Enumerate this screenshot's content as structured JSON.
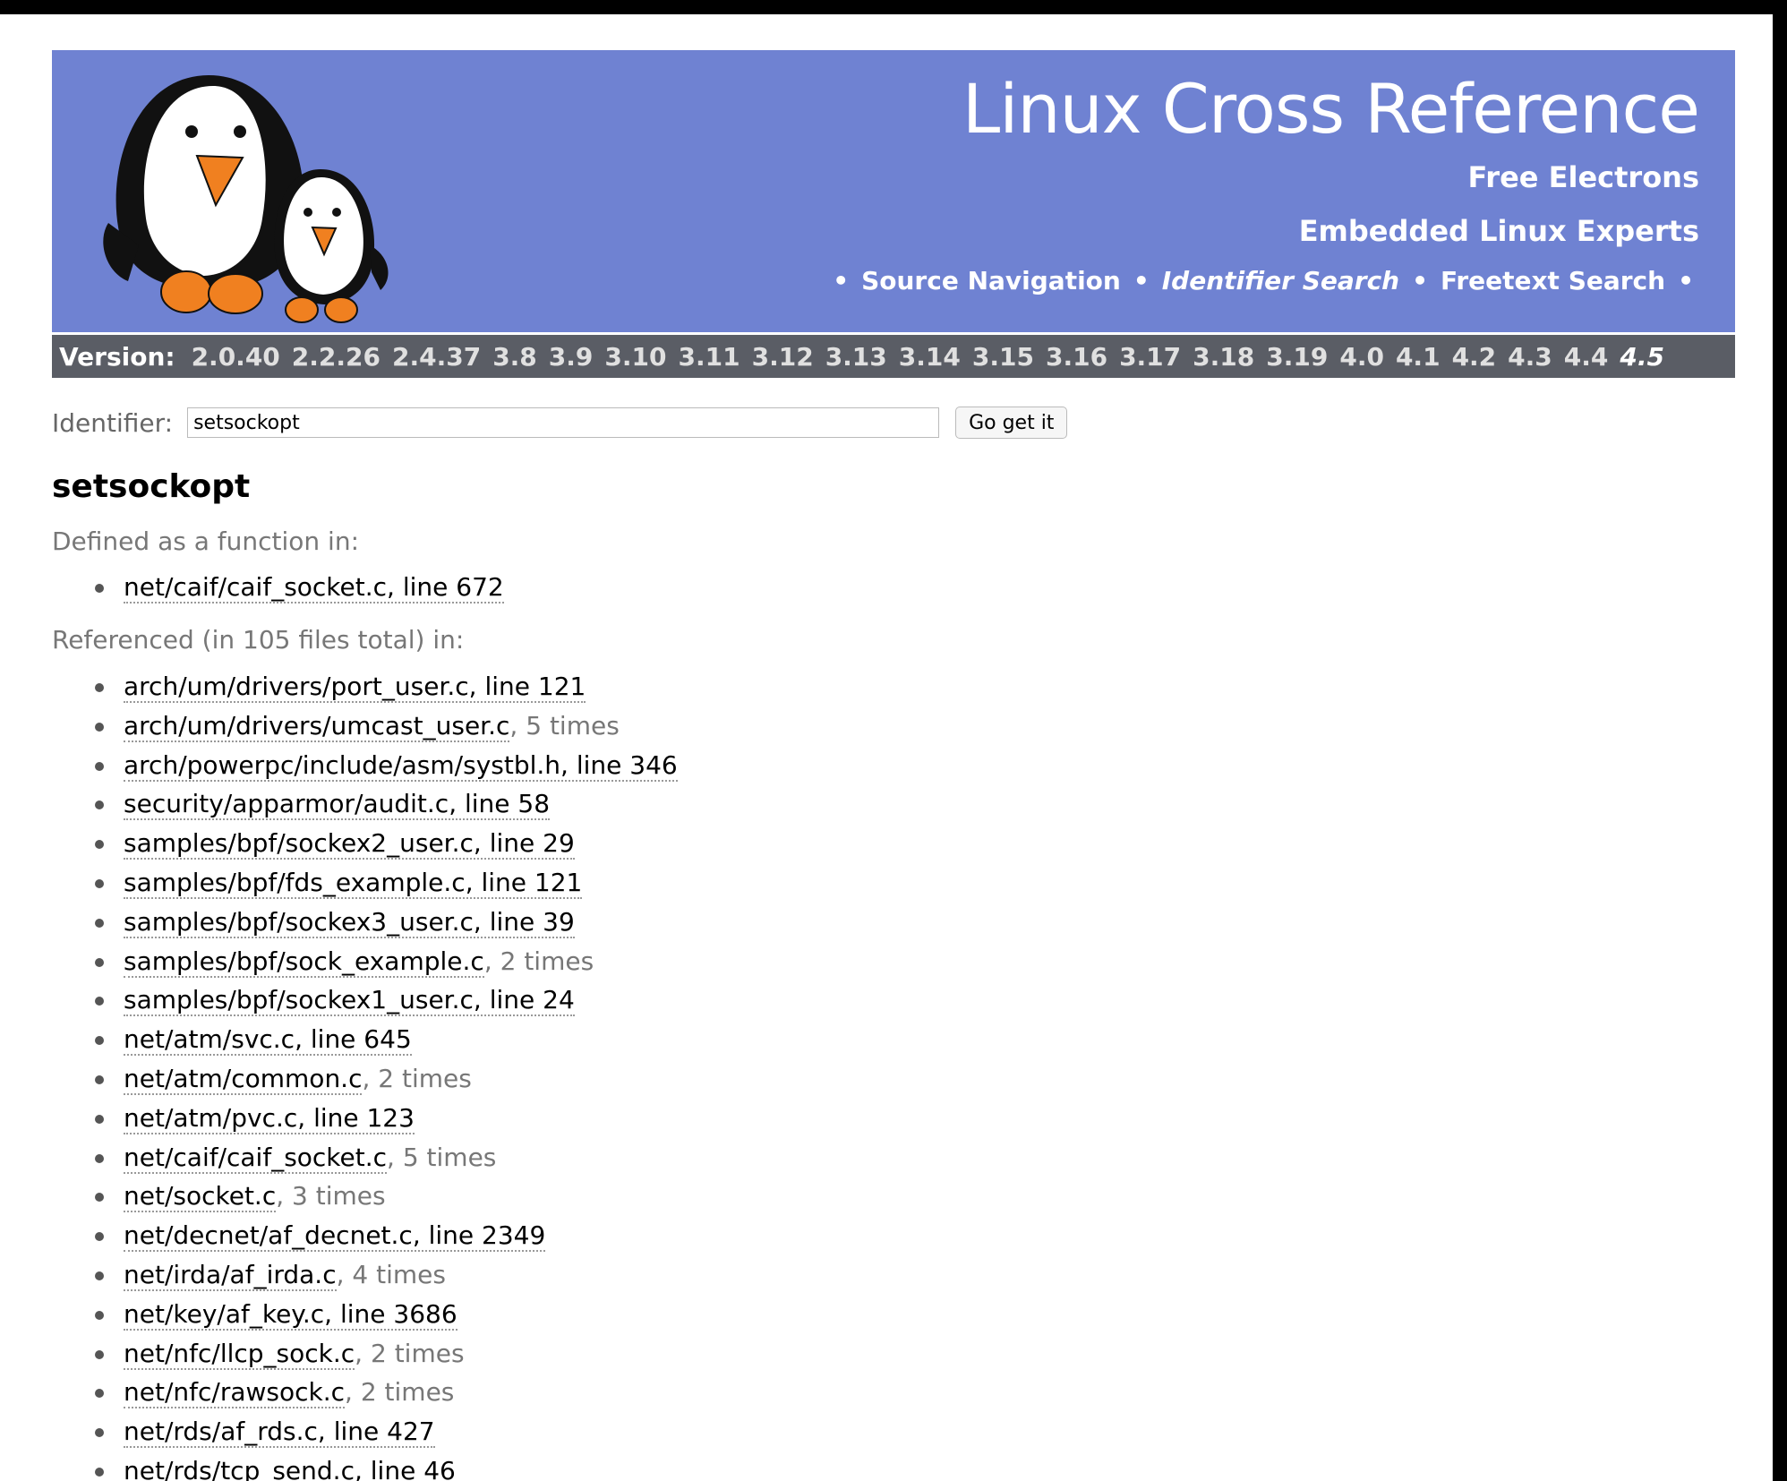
{
  "header": {
    "title": "Linux Cross Reference",
    "company": "Free Electrons",
    "tagline": "Embedded Linux Experts",
    "nav": [
      {
        "label": "Source Navigation",
        "current": false
      },
      {
        "label": "Identifier Search",
        "current": true
      },
      {
        "label": "Freetext Search",
        "current": false
      }
    ],
    "bullet": "•"
  },
  "versionbar": {
    "label": "Version:",
    "versions": [
      "2.0.40",
      "2.2.26",
      "2.4.37",
      "3.8",
      "3.9",
      "3.10",
      "3.11",
      "3.12",
      "3.13",
      "3.14",
      "3.15",
      "3.16",
      "3.17",
      "3.18",
      "3.19",
      "4.0",
      "4.1",
      "4.2",
      "4.3",
      "4.4",
      "4.5"
    ],
    "current": "4.5"
  },
  "search": {
    "label": "Identifier:",
    "value": "setsockopt",
    "button": "Go get it"
  },
  "identifier": "setsockopt",
  "defined": {
    "label": "Defined as a function in:",
    "items": [
      {
        "link": "net/caif/caif_socket.c, line 672",
        "suffix": ""
      }
    ]
  },
  "referenced": {
    "label": "Referenced (in 105 files total) in:",
    "items": [
      {
        "link": "arch/um/drivers/port_user.c, line 121",
        "suffix": ""
      },
      {
        "link": "arch/um/drivers/umcast_user.c",
        "suffix": ", 5 times"
      },
      {
        "link": "arch/powerpc/include/asm/systbl.h, line 346",
        "suffix": ""
      },
      {
        "link": "security/apparmor/audit.c, line 58",
        "suffix": ""
      },
      {
        "link": "samples/bpf/sockex2_user.c, line 29",
        "suffix": ""
      },
      {
        "link": "samples/bpf/fds_example.c, line 121",
        "suffix": ""
      },
      {
        "link": "samples/bpf/sockex3_user.c, line 39",
        "suffix": ""
      },
      {
        "link": "samples/bpf/sock_example.c",
        "suffix": ", 2 times"
      },
      {
        "link": "samples/bpf/sockex1_user.c, line 24",
        "suffix": ""
      },
      {
        "link": "net/atm/svc.c, line 645",
        "suffix": ""
      },
      {
        "link": "net/atm/common.c",
        "suffix": ", 2 times"
      },
      {
        "link": "net/atm/pvc.c, line 123",
        "suffix": ""
      },
      {
        "link": "net/caif/caif_socket.c",
        "suffix": ", 5 times"
      },
      {
        "link": "net/socket.c",
        "suffix": ", 3 times"
      },
      {
        "link": "net/decnet/af_decnet.c, line 2349",
        "suffix": ""
      },
      {
        "link": "net/irda/af_irda.c",
        "suffix": ", 4 times"
      },
      {
        "link": "net/key/af_key.c, line 3686",
        "suffix": ""
      },
      {
        "link": "net/nfc/llcp_sock.c",
        "suffix": ", 2 times"
      },
      {
        "link": "net/nfc/rawsock.c",
        "suffix": ", 2 times"
      },
      {
        "link": "net/rds/af_rds.c, line 427",
        "suffix": ""
      },
      {
        "link": "net/rds/tcp_send.c, line 46",
        "suffix": ""
      }
    ]
  },
  "colors": {
    "header_bg": "#6f82d2",
    "version_bar_bg": "#5a5d65",
    "penguin_beak_feet": "#f08020"
  }
}
